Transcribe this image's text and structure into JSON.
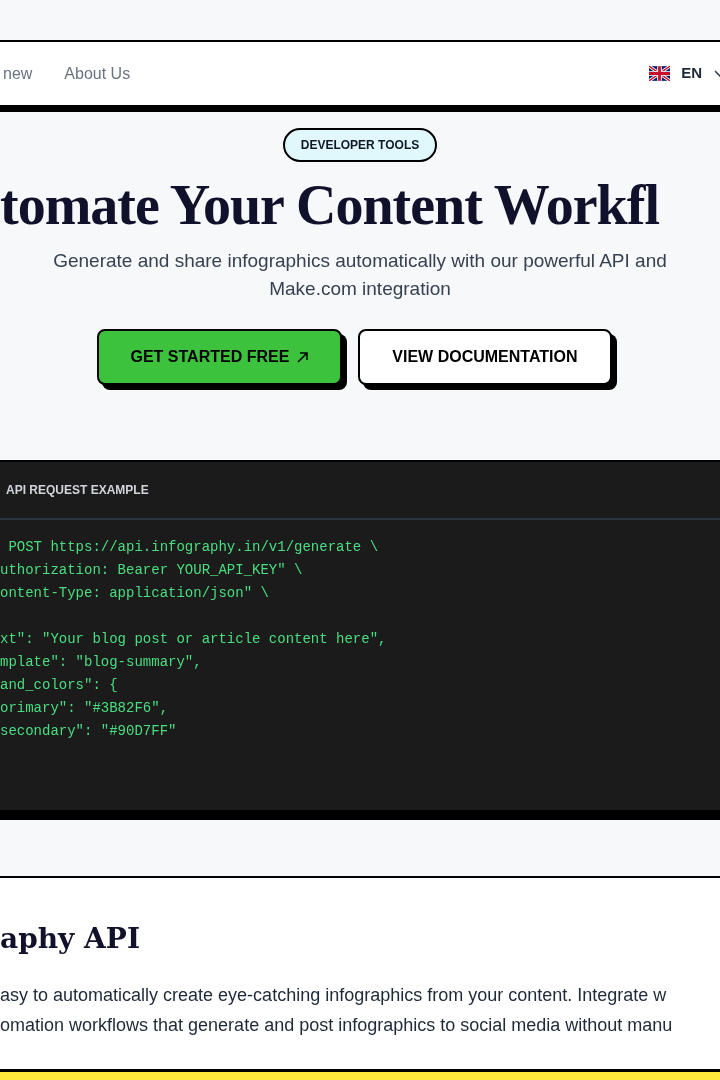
{
  "nav": {
    "links": [
      "new",
      "About Us"
    ],
    "language": {
      "code": "EN"
    }
  },
  "hero": {
    "badge": "DEVELOPER TOOLS",
    "title": "tomate Your Content Workfl",
    "subtitle": "Generate and share infographics automatically with our powerful API and Make.com integration",
    "buttons": [
      {
        "label": "GET STARTED FREE",
        "kind": "primary"
      },
      {
        "label": "VIEW DOCUMENTATION",
        "kind": "secondary"
      }
    ]
  },
  "code_panel": {
    "title": "API REQUEST EXAMPLE",
    "blocks": [
      [
        " POST https://api.infography.in/v1/generate \\",
        "uthorization: Bearer YOUR_API_KEY\" \\",
        "ontent-Type: application/json\" \\"
      ],
      [
        "xt\": \"Your blog post or article content here\",",
        "mplate\": \"blog-summary\",",
        "and_colors\": {",
        "orimary\": \"#3B82F6\",",
        "secondary\": \"#90D7FF\""
      ]
    ]
  },
  "section": {
    "title": "aphy API",
    "lines": [
      "asy to automatically create eye-catching infographics from your content. Integrate w",
      "omation workflows that generate and post infographics to social media without manu"
    ]
  }
}
